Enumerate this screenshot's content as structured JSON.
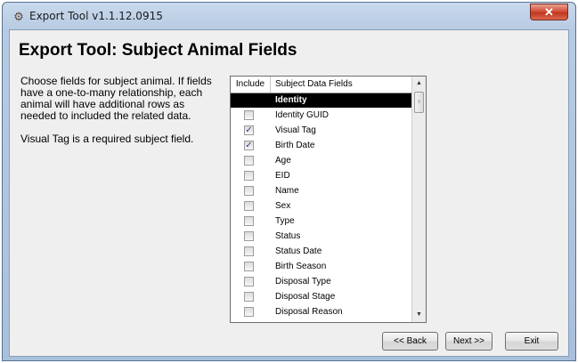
{
  "window": {
    "title": "Export Tool v1.1.12.0915",
    "app_icon": "gear-cluster-icon",
    "close_glyph": "✕"
  },
  "heading": "Export Tool:  Subject Animal Fields",
  "description": {
    "paragraph1": "Choose fields for subject animal.  If fields have a one-to-many relationship, each animal will have additional rows as needed to included the related data.",
    "paragraph2": "Visual Tag is a required subject field."
  },
  "grid": {
    "columns": {
      "include": "Include",
      "field": "Subject Data Fields"
    },
    "group_label": "Identity",
    "rows": [
      {
        "label": "Identity GUID",
        "checked": false
      },
      {
        "label": "Visual Tag",
        "checked": true
      },
      {
        "label": "Birth Date",
        "checked": true
      },
      {
        "label": "Age",
        "checked": false
      },
      {
        "label": "EID",
        "checked": false
      },
      {
        "label": "Name",
        "checked": false
      },
      {
        "label": "Sex",
        "checked": false
      },
      {
        "label": "Type",
        "checked": false
      },
      {
        "label": "Status",
        "checked": false
      },
      {
        "label": "Status Date",
        "checked": false
      },
      {
        "label": "Birth Season",
        "checked": false
      },
      {
        "label": "Disposal Type",
        "checked": false
      },
      {
        "label": "Disposal Stage",
        "checked": false
      },
      {
        "label": "Disposal Reason",
        "checked": false
      }
    ]
  },
  "buttons": {
    "back": "<< Back",
    "next": "Next >>",
    "exit": "Exit"
  },
  "colors": {
    "title_bar": "#b7cbe3",
    "close_button": "#c2361f",
    "group_row_bg": "#000000"
  }
}
